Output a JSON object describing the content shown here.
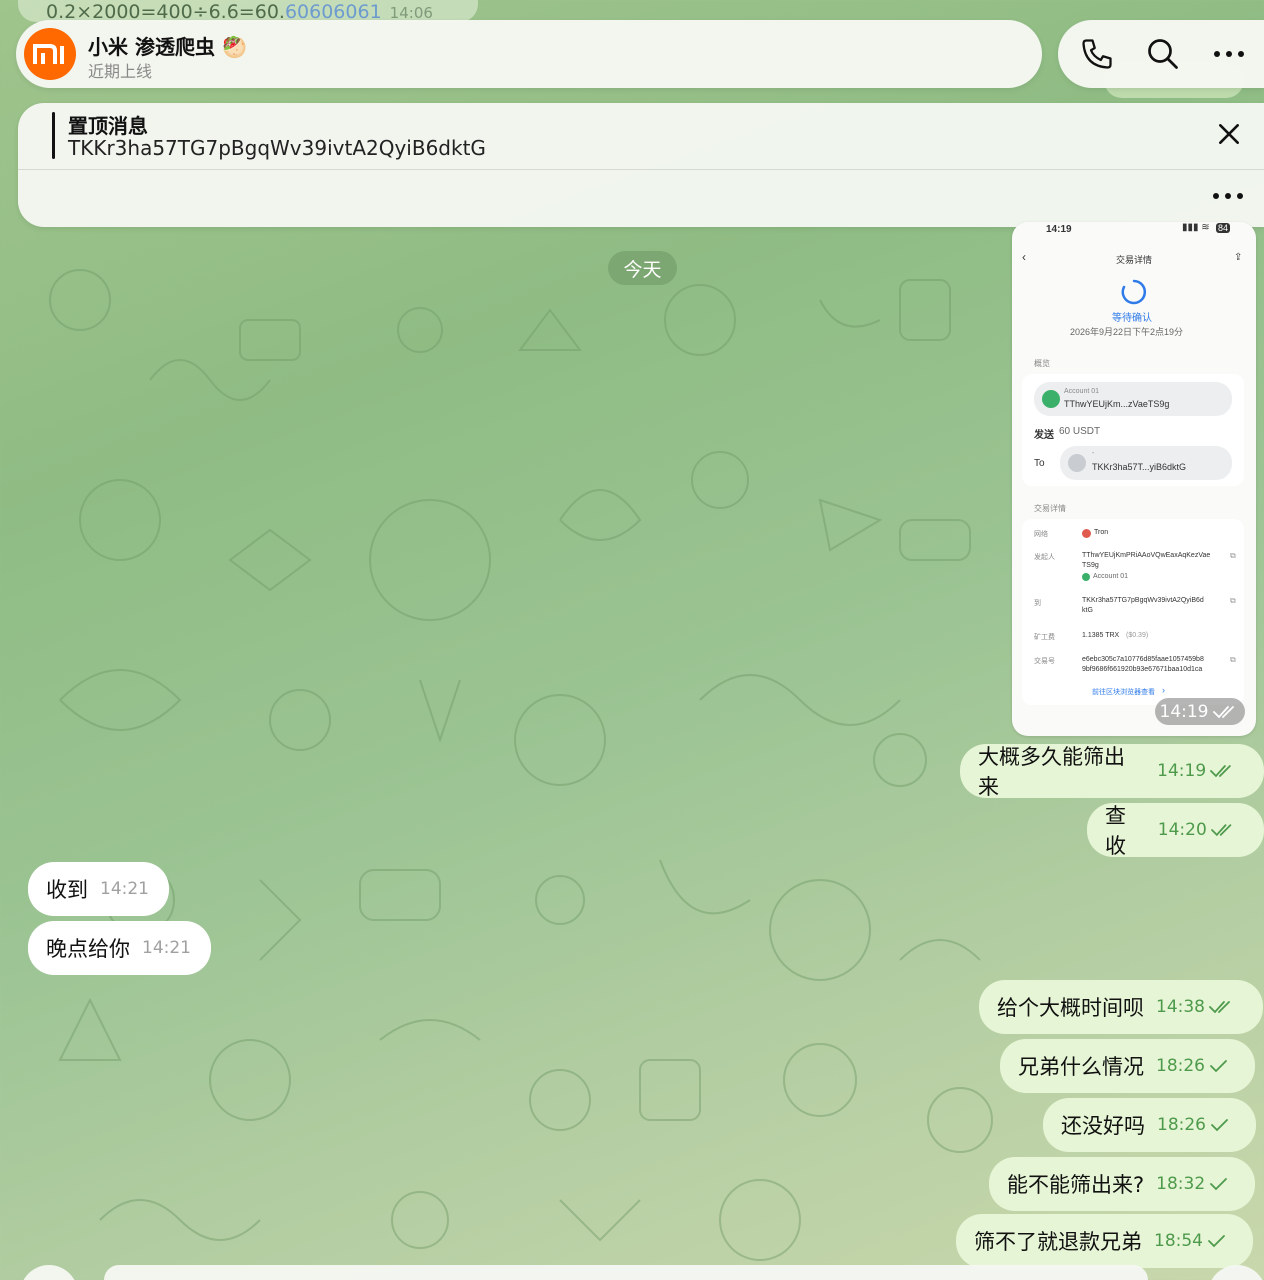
{
  "top_partial": {
    "text": "0.2×2000=400÷6.6=60.",
    "text_blue": "60606061",
    "time": "14:06"
  },
  "header": {
    "avatar_logo": "mi",
    "title": "小米 渗透爬虫",
    "title_emoji": "🥙",
    "status": "近期上线"
  },
  "pinned": {
    "title": "置顶消息",
    "text": "TKKr3ha57TG7pBgqWv39ivtA2QyiB6dktG"
  },
  "date_separator": "今天",
  "screenshot": {
    "status_time": "14:19",
    "battery": "84",
    "page_title": "交易详情",
    "status_text": "等待确认",
    "datetime": "2026年9月22日下午2点19分",
    "overview_label": "概览",
    "from_account": "Account 01",
    "from_address": "TThwYEUjKm...zVaeTS9g",
    "send_label": "发送",
    "send_amount": "60 USDT",
    "to_label": "To",
    "to_dash": "-",
    "to_address": "TKKr3ha57T...yiB6dktG",
    "details_label": "交易详情",
    "network_label": "网络",
    "network_value": "Tron",
    "initiator_label": "发起人",
    "initiator_value_1": "TThwYEUjKmPRiAAoVQwEaxAqKezVae",
    "initiator_value_2": "TS9g",
    "initiator_account": "Account 01",
    "to_row_label": "到",
    "to_row_value_1": "TKKr3ha57TG7pBgqWv39ivtA2QyiB6d",
    "to_row_value_2": "ktG",
    "fee_label": "矿工费",
    "fee_value": "1.1385 TRX",
    "fee_usd": "($0.39)",
    "hash_label": "交易号",
    "hash_value_1": "e6ebc305c7a10776d85faae1057459b8",
    "hash_value_2": "9bf9686f661920b93e67671baa10d1ca",
    "explorer_link": "前往区块浏览器查看",
    "message_time": "14:19"
  },
  "messages": [
    {
      "dir": "out",
      "text": "大概多久能筛出来",
      "time": "14:19",
      "status": "read"
    },
    {
      "dir": "out",
      "text": "查收",
      "time": "14:20",
      "status": "read"
    },
    {
      "dir": "in",
      "text": "收到",
      "time": "14:21"
    },
    {
      "dir": "in",
      "text": "晚点给你",
      "time": "14:21"
    },
    {
      "dir": "out",
      "text": "给个大概时间呗",
      "time": "14:38",
      "status": "read"
    },
    {
      "dir": "out",
      "text": "兄弟什么情况",
      "time": "18:26",
      "status": "sent"
    },
    {
      "dir": "out",
      "text": "还没好吗",
      "time": "18:26",
      "status": "sent"
    },
    {
      "dir": "out",
      "text": "能不能筛出来?",
      "time": "18:32",
      "status": "sent"
    },
    {
      "dir": "out",
      "text": "筛不了就退款兄弟",
      "time": "18:54",
      "status": "sent"
    }
  ],
  "colors": {
    "accent_green": "#4e9a4c",
    "outgoing_bubble": "#e6f5d5",
    "incoming_bubble": "#ffffff",
    "xiaomi_orange": "#ff6900",
    "wallet_blue": "#2f7bea"
  }
}
